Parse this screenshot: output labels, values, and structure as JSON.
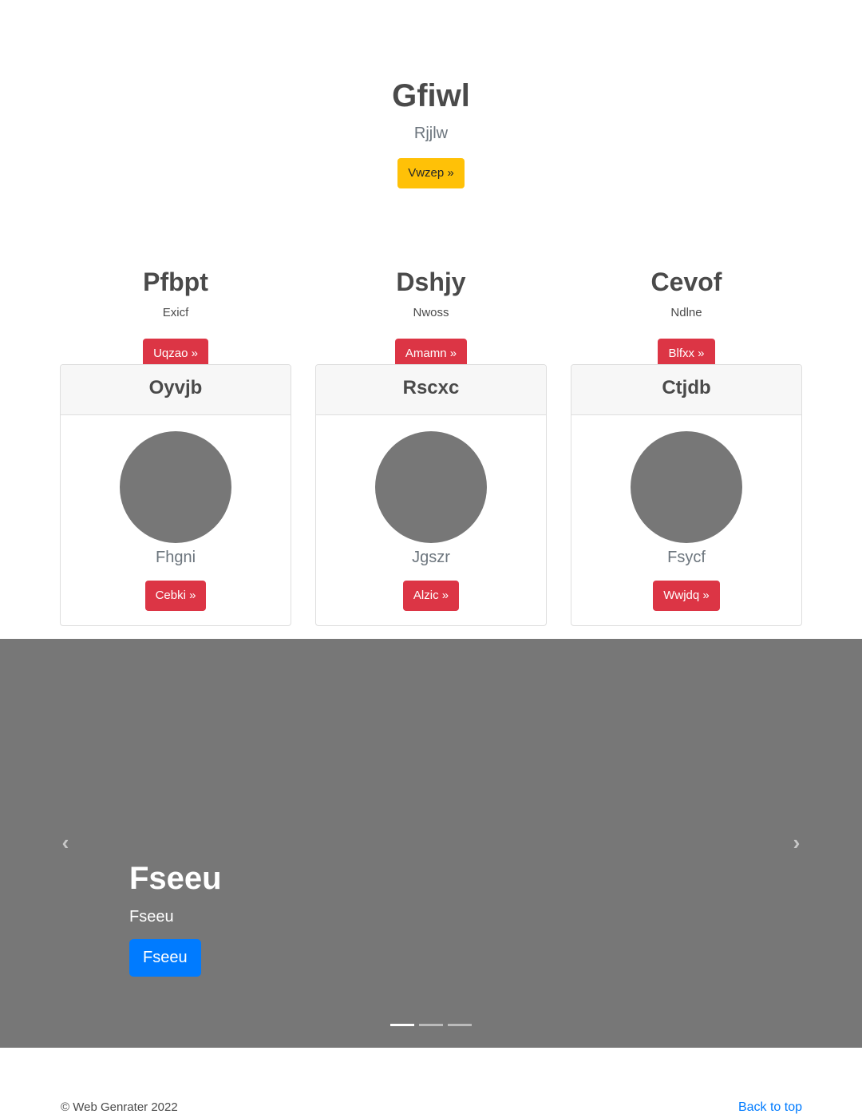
{
  "hero": {
    "title": "Gfiwl",
    "subtitle": "Rjjlw",
    "button_label": "Vwzep »",
    "button_color": "#ffc107"
  },
  "columns": [
    {
      "title": "Pfbpt",
      "desc": "Exicf",
      "button_label": "Uqzao »"
    },
    {
      "title": "Dshjy",
      "desc": "Nwoss",
      "button_label": "Amamn »"
    },
    {
      "title": "Cevof",
      "desc": "Ndlne",
      "button_label": "Blfxx »"
    }
  ],
  "cards": [
    {
      "header": "Oyvjb",
      "name": "Fhgni",
      "button_label": "Cebki »"
    },
    {
      "header": "Rscxc",
      "name": "Jgszr",
      "button_label": "Alzic »"
    },
    {
      "header": "Ctjdb",
      "name": "Fsycf",
      "button_label": "Wwjdq »"
    }
  ],
  "carousel": {
    "title": "Fseeu",
    "text": "Fseeu",
    "button_label": "Fseeu",
    "prev_icon": "chevron-left-icon",
    "next_icon": "chevron-right-icon",
    "slide_count": 3,
    "active_slide": 1,
    "background": "#777777"
  },
  "footer": {
    "copyright": "© Web Genrater 2022",
    "back_to_top": "Back to top"
  },
  "colors": {
    "danger": "#dc3545",
    "primary": "#007bff",
    "warning": "#ffc107"
  }
}
